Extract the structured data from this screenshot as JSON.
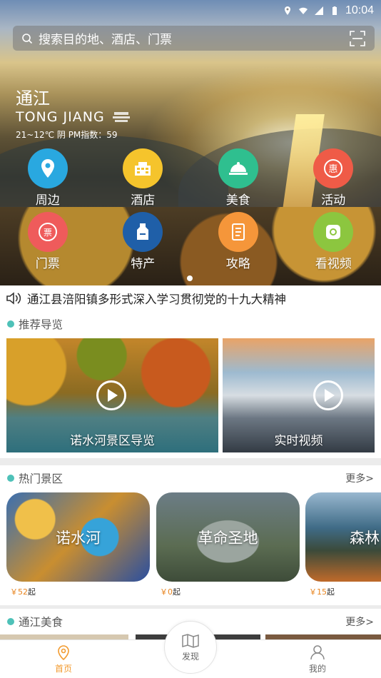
{
  "status_bar": {
    "time": "10:04"
  },
  "search": {
    "placeholder": "搜索目的地、酒店、门票"
  },
  "city": {
    "name": "通江",
    "pinyin": "TONG JIANG",
    "weather": "21~12℃ 阴 PM指数：59"
  },
  "menu": [
    {
      "label": "周边",
      "icon": "location-pin-icon",
      "color": "#29a8e0"
    },
    {
      "label": "酒店",
      "icon": "hotel-icon",
      "color": "#f5c42c"
    },
    {
      "label": "美食",
      "icon": "dish-cloche-icon",
      "color": "#2fbf8f"
    },
    {
      "label": "活动",
      "icon": "discount-hui-icon",
      "color": "#ef5b47"
    },
    {
      "label": "门票",
      "icon": "ticket-icon",
      "color": "#ef5b5b"
    },
    {
      "label": "特产",
      "icon": "specialty-bag-icon",
      "color": "#1f5fa8"
    },
    {
      "label": "攻略",
      "icon": "guide-book-icon",
      "color": "#f5963a"
    },
    {
      "label": "看视频",
      "icon": "video-icon",
      "color": "#8cc63f"
    }
  ],
  "notice": {
    "text": "通江县涪阳镇多形式深入学习贯彻党的十九大精神"
  },
  "guide": {
    "title": "推荐导览",
    "cards": [
      {
        "label": "诺水河景区导览"
      },
      {
        "label": "实时视频"
      }
    ]
  },
  "hot": {
    "title": "热门景区",
    "more": "更多>",
    "items": [
      {
        "name": "诺水河",
        "price": "￥52",
        "unit": "起"
      },
      {
        "name": "革命圣地",
        "price": "￥0",
        "unit": "起"
      },
      {
        "name": "森林",
        "price": "￥15",
        "unit": "起"
      }
    ]
  },
  "food": {
    "title": "通江美食",
    "more": "更多>"
  },
  "nav": {
    "home": "首页",
    "discover": "发现",
    "mine": "我的"
  },
  "colors": {
    "accent": "#f29a2e",
    "section_dot": "#4ec1b8",
    "price": "#e8841f"
  }
}
